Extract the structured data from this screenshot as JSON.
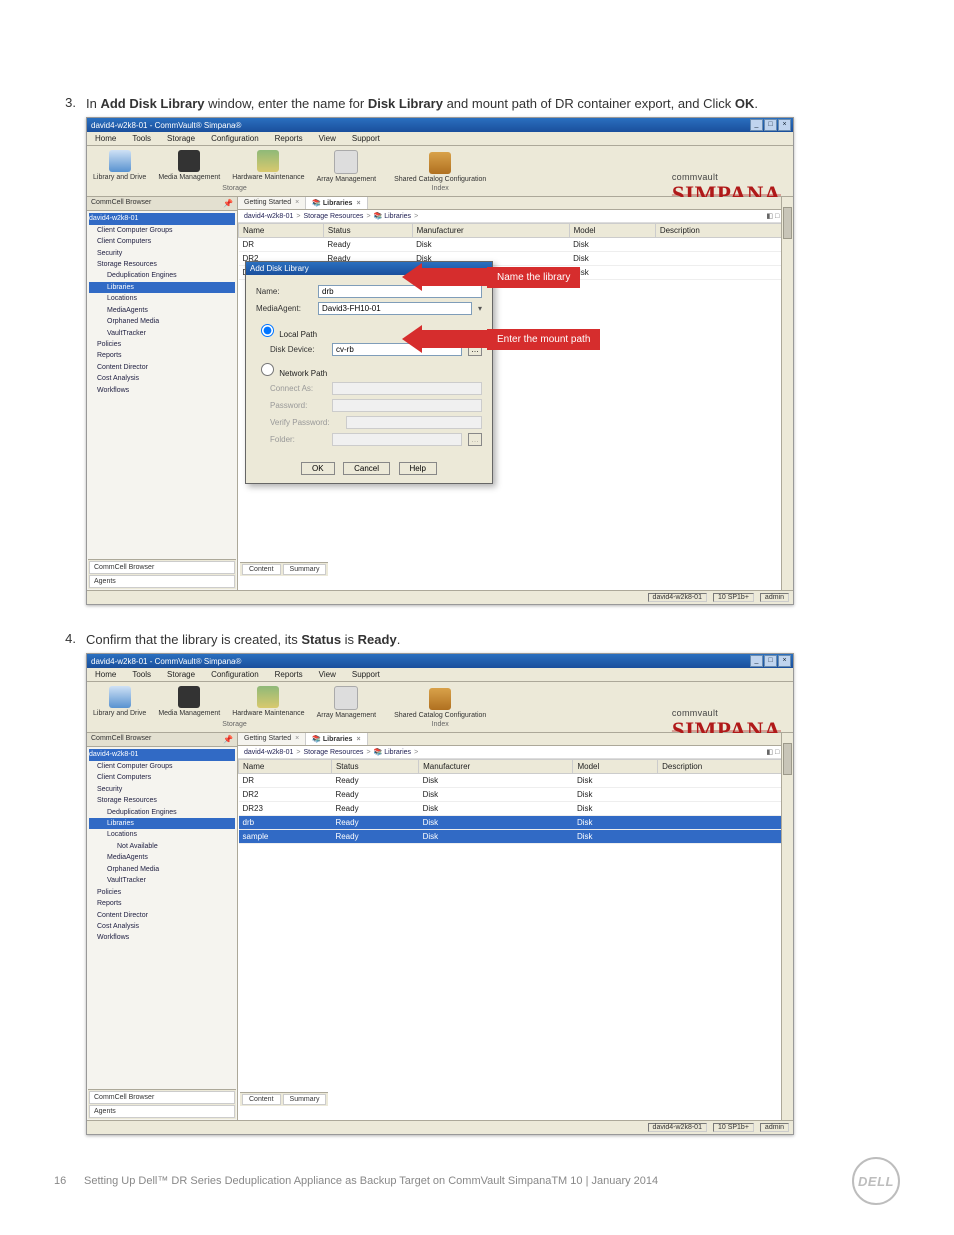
{
  "steps": {
    "s3": {
      "num": "3.",
      "text_pre": "In ",
      "b1": "Add Disk Library",
      "text_mid1": " window, enter the name for ",
      "b2": "Disk Library",
      "text_mid2": " and mount path of DR container export, and Click ",
      "b3": "OK",
      "text_end": "."
    },
    "s4": {
      "num": "4.",
      "text_pre": "Confirm that the library is created, its ",
      "b1": "Status",
      "text_mid1": " is ",
      "b2": "Ready",
      "text_end": "."
    }
  },
  "win_title": "david4-w2k8-01 - CommVault® Simpana®",
  "menus": [
    "Home",
    "Tools",
    "Storage",
    "Configuration",
    "Reports",
    "View",
    "Support"
  ],
  "toolbar_buttons": [
    {
      "label": "Library and Drive"
    },
    {
      "label": "Media Management"
    },
    {
      "label": "Hardware Maintenance"
    },
    {
      "label": "Array Management"
    },
    {
      "label": "Shared Catalog Configuration"
    }
  ],
  "toolbar_groups": [
    "Storage",
    "Index"
  ],
  "brand": {
    "company": "commvault",
    "product": "SIMPANA"
  },
  "tree_panel_title": "CommCell Browser",
  "tree1": [
    {
      "label": "david4-w2k8-01",
      "indent": 0,
      "sel": true
    },
    {
      "label": "Client Computer Groups",
      "indent": 1
    },
    {
      "label": "Client Computers",
      "indent": 1
    },
    {
      "label": "Security",
      "indent": 1
    },
    {
      "label": "Storage Resources",
      "indent": 1
    },
    {
      "label": "Deduplication Engines",
      "indent": 2
    },
    {
      "label": "Libraries",
      "indent": 2,
      "selBlue": true
    },
    {
      "label": "Locations",
      "indent": 2
    },
    {
      "label": "MediaAgents",
      "indent": 2
    },
    {
      "label": "Orphaned Media",
      "indent": 2
    },
    {
      "label": "VaultTracker",
      "indent": 2
    },
    {
      "label": "Policies",
      "indent": 1
    },
    {
      "label": "Reports",
      "indent": 1
    },
    {
      "label": "Content Director",
      "indent": 1
    },
    {
      "label": "Cost Analysis",
      "indent": 1
    },
    {
      "label": "Workflows",
      "indent": 1
    }
  ],
  "tree2": [
    {
      "label": "david4-w2k8-01",
      "indent": 0,
      "sel": true
    },
    {
      "label": "Client Computer Groups",
      "indent": 1
    },
    {
      "label": "Client Computers",
      "indent": 1
    },
    {
      "label": "Security",
      "indent": 1
    },
    {
      "label": "Storage Resources",
      "indent": 1
    },
    {
      "label": "Deduplication Engines",
      "indent": 2
    },
    {
      "label": "Libraries",
      "indent": 2,
      "selBlue": true
    },
    {
      "label": "Locations",
      "indent": 2
    },
    {
      "label": "Not Available",
      "indent": 3
    },
    {
      "label": "MediaAgents",
      "indent": 2
    },
    {
      "label": "Orphaned Media",
      "indent": 2
    },
    {
      "label": "VaultTracker",
      "indent": 2
    },
    {
      "label": "Policies",
      "indent": 1
    },
    {
      "label": "Reports",
      "indent": 1
    },
    {
      "label": "Content Director",
      "indent": 1
    },
    {
      "label": "Cost Analysis",
      "indent": 1
    },
    {
      "label": "Workflows",
      "indent": 1
    }
  ],
  "browser_tabs": [
    "CommCell Browser",
    "Agents"
  ],
  "tabs": {
    "getting": "Getting Started",
    "libraries": "Libraries"
  },
  "breadcrumb_parts": [
    "david4-w2k8-01",
    "Storage Resources",
    "Libraries"
  ],
  "table_headers": [
    "Name",
    "Status",
    "Manufacturer",
    "Model",
    "Description"
  ],
  "table1_rows": [
    {
      "name": "DR",
      "status": "Ready",
      "manuf": "Disk",
      "model": "Disk",
      "desc": ""
    },
    {
      "name": "DR2",
      "status": "Ready",
      "manuf": "Disk",
      "model": "Disk",
      "desc": ""
    },
    {
      "name": "DR23",
      "status": "Ready",
      "manuf": "Disk",
      "model": "Disk",
      "desc": ""
    }
  ],
  "table2_rows": [
    {
      "name": "DR",
      "status": "Ready",
      "manuf": "Disk",
      "model": "Disk",
      "desc": ""
    },
    {
      "name": "DR2",
      "status": "Ready",
      "manuf": "Disk",
      "model": "Disk",
      "desc": ""
    },
    {
      "name": "DR23",
      "status": "Ready",
      "manuf": "Disk",
      "model": "Disk",
      "desc": ""
    },
    {
      "name": "drb",
      "status": "Ready",
      "manuf": "Disk",
      "model": "Disk",
      "desc": "",
      "sel": false
    },
    {
      "name": "sample",
      "status": "Ready",
      "manuf": "Disk",
      "model": "Disk",
      "desc": "",
      "sel": true
    }
  ],
  "dialog": {
    "title": "Add Disk Library",
    "name_label": "Name:",
    "name_value": "drb",
    "mediaagent_label": "MediaAgent:",
    "mediaagent_value": "David3-FH10-01",
    "local_path_label": "Local Path",
    "disk_device_label": "Disk Device:",
    "disk_device_value": "cv-rb",
    "network_path_label": "Network Path",
    "connect_as_label": "Connect As:",
    "password_label": "Password:",
    "verify_label": "Verify Password:",
    "folder_label": "Folder:",
    "btn_ok": "OK",
    "btn_cancel": "Cancel",
    "btn_help": "Help"
  },
  "callouts": {
    "name": "Name the library",
    "mount": "Enter the mount path"
  },
  "sub_tabs": [
    "Content",
    "Summary"
  ],
  "statusbar": {
    "server": "david4-w2k8-01",
    "version": "10 SP1b+",
    "user": "admin"
  },
  "footer": {
    "page": "16",
    "text": "Setting Up Dell™ DR Series Deduplication Appliance as Backup Target on CommVault SimpanaTM 10 | January 2014",
    "logo": "DELL"
  }
}
